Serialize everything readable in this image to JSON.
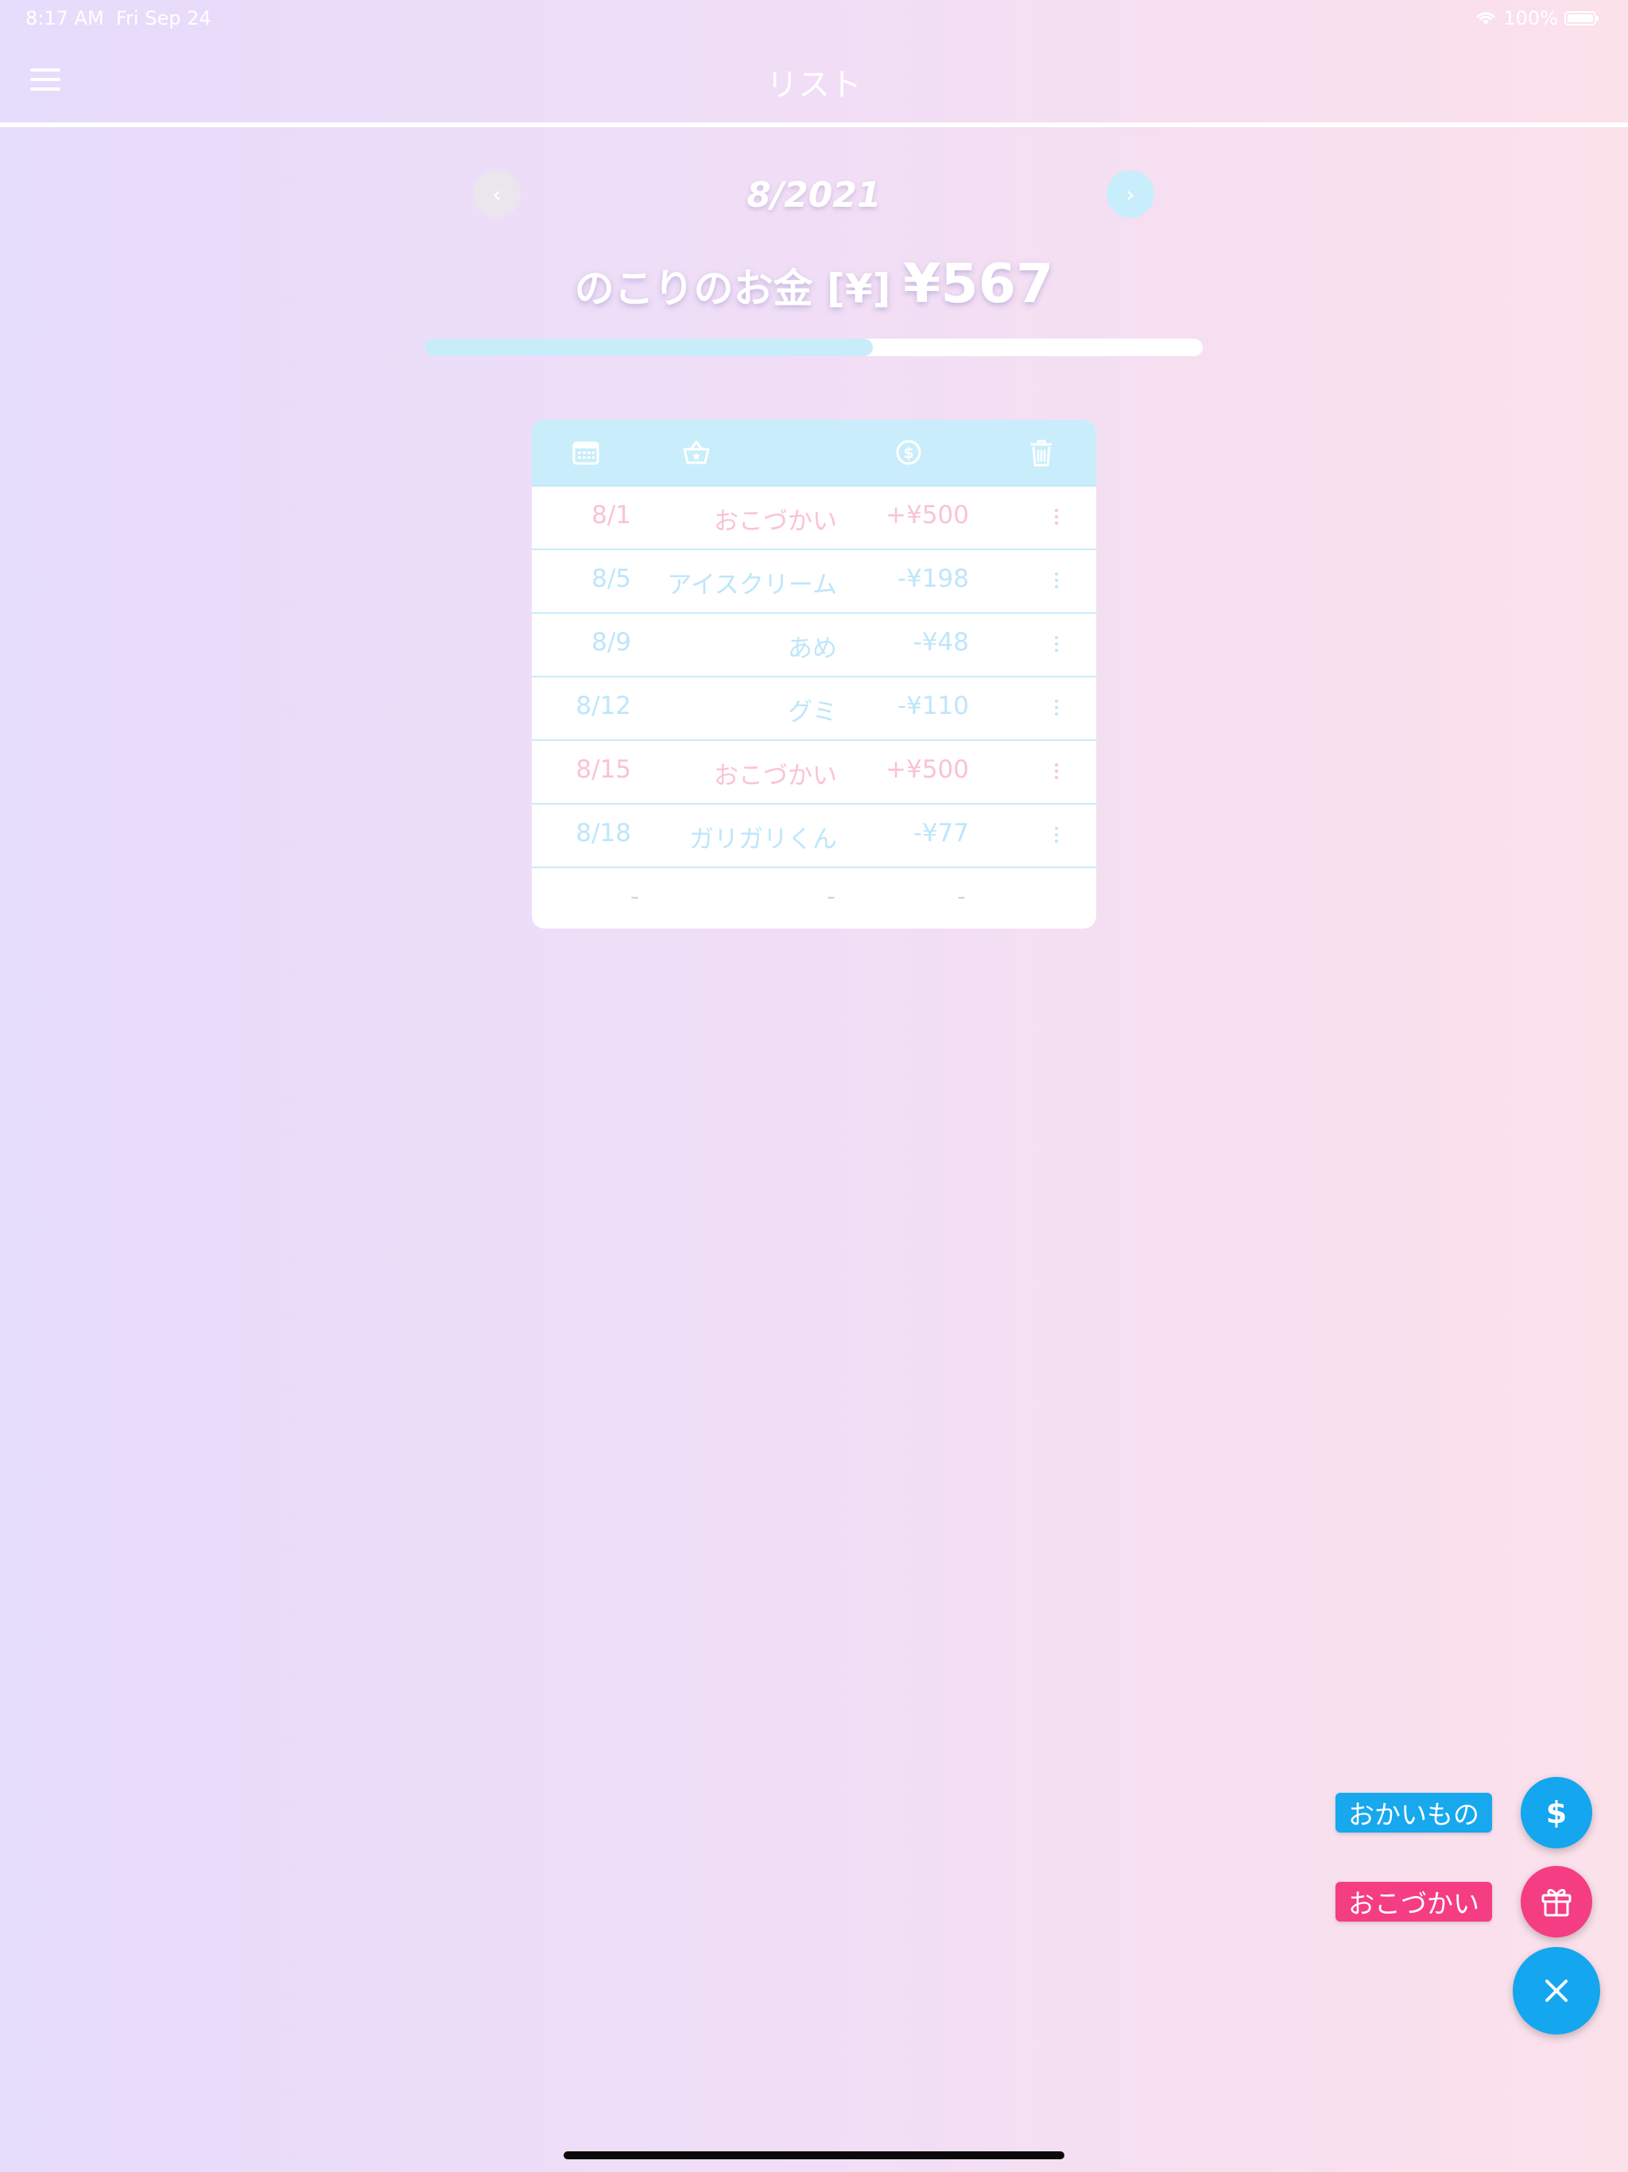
{
  "status_bar": {
    "time": "8:17 AM",
    "date": "Fri Sep 24",
    "battery": "100%"
  },
  "header": {
    "title": "リスト",
    "menu_icon": "hamburger-menu-icon"
  },
  "month_nav": {
    "prev_symbol": "‹",
    "next_symbol": "›",
    "label": "8/2021"
  },
  "balance": {
    "label": "のこりのお金 [¥]",
    "amount": "¥567",
    "progress_fraction": 0.576
  },
  "table": {
    "header_icons": [
      "calendar-icon",
      "basket-icon",
      "coin-icon",
      "trash-icon"
    ],
    "rows": [
      {
        "date": "8/1",
        "item": "おこづかい",
        "amount": "+¥500",
        "type": "income"
      },
      {
        "date": "8/5",
        "item": "アイスクリーム",
        "amount": "-¥198",
        "type": "expense"
      },
      {
        "date": "8/9",
        "item": "あめ",
        "amount": "-¥48",
        "type": "expense"
      },
      {
        "date": "8/12",
        "item": "グミ",
        "amount": "-¥110",
        "type": "expense"
      },
      {
        "date": "8/15",
        "item": "おこづかい",
        "amount": "+¥500",
        "type": "income"
      },
      {
        "date": "8/18",
        "item": "ガリガリくん",
        "amount": "-¥77",
        "type": "expense"
      }
    ],
    "empty_row": {
      "date": "-",
      "item": "-",
      "amount": "-"
    }
  },
  "fab_menu": {
    "purchase_label": "おかいもの",
    "purchase_symbol": "$",
    "allowance_label": "おこづかい",
    "allowance_icon": "gift-icon",
    "close_icon": "close-icon"
  },
  "colors": {
    "accent_blue": "#14a6ee",
    "accent_pink": "#f43d82",
    "income_text": "#f9c3d4",
    "expense_text": "#bde6fa"
  }
}
